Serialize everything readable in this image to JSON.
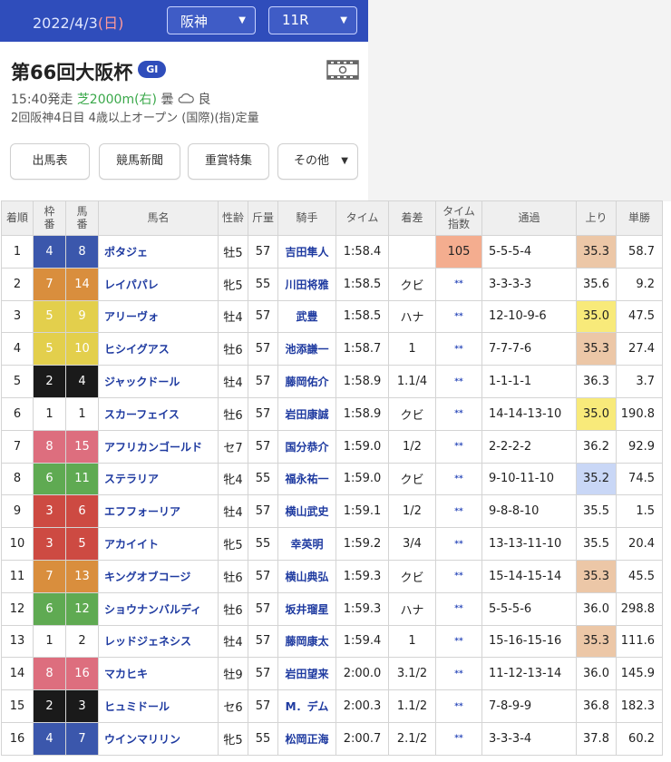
{
  "header": {
    "date": "2022/4/3",
    "weekday": "(日)",
    "venue": "阪神",
    "race": "11R"
  },
  "race": {
    "title": "第66回大阪杯",
    "grade": "GI",
    "start": "15:40発走",
    "course": "芝2000m(右)",
    "weather": "曇",
    "condition": "良",
    "detail": "2回阪神4日目 4歳以上オープン (国際)(指)定量"
  },
  "nav": {
    "entries": "出馬表",
    "newspaper": "競馬新聞",
    "feature": "重賞特集",
    "other": "その他"
  },
  "table": {
    "headers": {
      "rank": "着順",
      "waku_1": "枠",
      "waku_2": "番",
      "uma_1": "馬",
      "uma_2": "番",
      "name": "馬名",
      "sexage": "性齢",
      "weight": "斤量",
      "jockey": "騎手",
      "time": "タイム",
      "margin": "着差",
      "index_1": "タイム",
      "index_2": "指数",
      "pass": "通過",
      "last": "上り",
      "odds": "単勝"
    },
    "rows": [
      {
        "rank": "1",
        "waku": "4",
        "num": "8",
        "name": "ポタジェ",
        "sexage": "牡5",
        "weight": "57",
        "jockey": "吉田隼人",
        "time": "1:58.4",
        "margin": "",
        "index": "105",
        "pass": "5-5-5-4",
        "last": "35.3",
        "odds": "58.7"
      },
      {
        "rank": "2",
        "waku": "7",
        "num": "14",
        "name": "レイパパレ",
        "sexage": "牝5",
        "weight": "55",
        "jockey": "川田将雅",
        "time": "1:58.5",
        "margin": "クビ",
        "index": "**",
        "pass": "3-3-3-3",
        "last": "35.6",
        "odds": "9.2"
      },
      {
        "rank": "3",
        "waku": "5",
        "num": "9",
        "name": "アリーヴォ",
        "sexage": "牡4",
        "weight": "57",
        "jockey": "武豊",
        "time": "1:58.5",
        "margin": "ハナ",
        "index": "**",
        "pass": "12-10-9-6",
        "last": "35.0",
        "odds": "47.5"
      },
      {
        "rank": "4",
        "waku": "5",
        "num": "10",
        "name": "ヒシイグアス",
        "sexage": "牡6",
        "weight": "57",
        "jockey": "池添謙一",
        "time": "1:58.7",
        "margin": "1",
        "index": "**",
        "pass": "7-7-7-6",
        "last": "35.3",
        "odds": "27.4"
      },
      {
        "rank": "5",
        "waku": "2",
        "num": "4",
        "name": "ジャックドール",
        "sexage": "牡4",
        "weight": "57",
        "jockey": "藤岡佑介",
        "time": "1:58.9",
        "margin": "1.1/4",
        "index": "**",
        "pass": "1-1-1-1",
        "last": "36.3",
        "odds": "3.7"
      },
      {
        "rank": "6",
        "waku": "1",
        "num": "1",
        "name": "スカーフェイス",
        "sexage": "牡6",
        "weight": "57",
        "jockey": "岩田康誠",
        "time": "1:58.9",
        "margin": "クビ",
        "index": "**",
        "pass": "14-14-13-10",
        "last": "35.0",
        "odds": "190.8"
      },
      {
        "rank": "7",
        "waku": "8",
        "num": "15",
        "name": "アフリカンゴールド",
        "sexage": "セ7",
        "weight": "57",
        "jockey": "国分恭介",
        "time": "1:59.0",
        "margin": "1/2",
        "index": "**",
        "pass": "2-2-2-2",
        "last": "36.2",
        "odds": "92.9"
      },
      {
        "rank": "8",
        "waku": "6",
        "num": "11",
        "name": "ステラリア",
        "sexage": "牝4",
        "weight": "55",
        "jockey": "福永祐一",
        "time": "1:59.0",
        "margin": "クビ",
        "index": "**",
        "pass": "9-10-11-10",
        "last": "35.2",
        "odds": "74.5"
      },
      {
        "rank": "9",
        "waku": "3",
        "num": "6",
        "name": "エフフォーリア",
        "sexage": "牡4",
        "weight": "57",
        "jockey": "横山武史",
        "time": "1:59.1",
        "margin": "1/2",
        "index": "**",
        "pass": "9-8-8-10",
        "last": "35.5",
        "odds": "1.5"
      },
      {
        "rank": "10",
        "waku": "3",
        "num": "5",
        "name": "アカイイト",
        "sexage": "牝5",
        "weight": "55",
        "jockey": "幸英明",
        "time": "1:59.2",
        "margin": "3/4",
        "index": "**",
        "pass": "13-13-11-10",
        "last": "35.5",
        "odds": "20.4"
      },
      {
        "rank": "11",
        "waku": "7",
        "num": "13",
        "name": "キングオブコージ",
        "sexage": "牡6",
        "weight": "57",
        "jockey": "横山典弘",
        "time": "1:59.3",
        "margin": "クビ",
        "index": "**",
        "pass": "15-14-15-14",
        "last": "35.3",
        "odds": "45.5"
      },
      {
        "rank": "12",
        "waku": "6",
        "num": "12",
        "name": "ショウナンバルディ",
        "sexage": "牡6",
        "weight": "57",
        "jockey": "坂井瑠星",
        "time": "1:59.3",
        "margin": "ハナ",
        "index": "**",
        "pass": "5-5-5-6",
        "last": "36.0",
        "odds": "298.8"
      },
      {
        "rank": "13",
        "waku": "1",
        "num": "2",
        "name": "レッドジェネシス",
        "sexage": "牡4",
        "weight": "57",
        "jockey": "藤岡康太",
        "time": "1:59.4",
        "margin": "1",
        "index": "**",
        "pass": "15-16-15-16",
        "last": "35.3",
        "odds": "111.6"
      },
      {
        "rank": "14",
        "waku": "8",
        "num": "16",
        "name": "マカヒキ",
        "sexage": "牡9",
        "weight": "57",
        "jockey": "岩田望来",
        "time": "2:00.0",
        "margin": "3.1/2",
        "index": "**",
        "pass": "11-12-13-14",
        "last": "36.0",
        "odds": "145.9"
      },
      {
        "rank": "15",
        "waku": "2",
        "num": "3",
        "name": "ヒュミドール",
        "sexage": "セ6",
        "weight": "57",
        "jockey": "M．デム",
        "time": "2:00.3",
        "margin": "1.1/2",
        "index": "**",
        "pass": "7-8-9-9",
        "last": "36.8",
        "odds": "182.3"
      },
      {
        "rank": "16",
        "waku": "4",
        "num": "7",
        "name": "ウインマリリン",
        "sexage": "牝5",
        "weight": "55",
        "jockey": "松岡正海",
        "time": "2:00.7",
        "margin": "2.1/2",
        "index": "**",
        "pass": "3-3-3-4",
        "last": "37.8",
        "odds": "60.2"
      }
    ]
  }
}
